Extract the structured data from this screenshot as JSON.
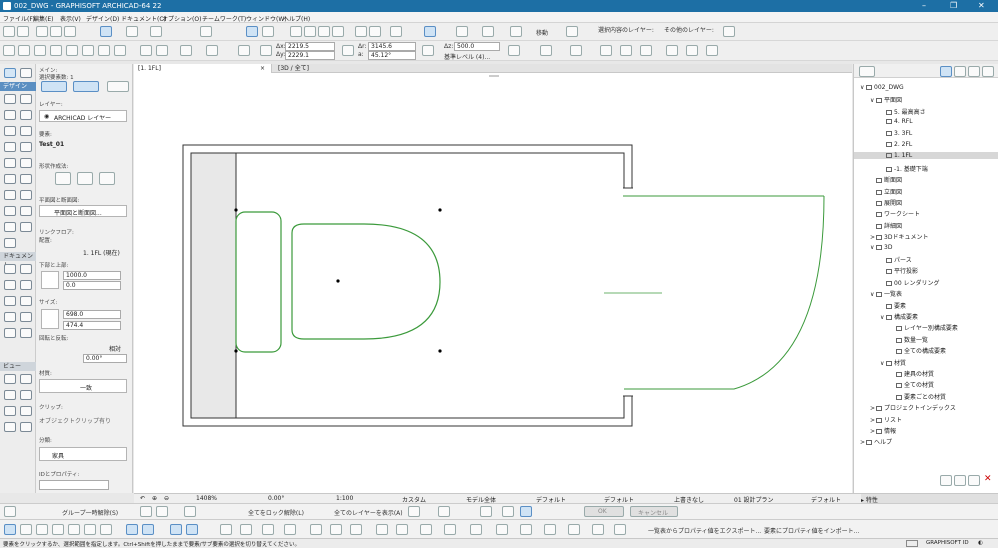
{
  "window": {
    "title": "002_DWG - GRAPHISOFT ARCHICAD-64 22",
    "minimize": "–",
    "maximize": "❐",
    "close": "✕"
  },
  "menu": [
    "ファイル(F)",
    "編集(E)",
    "表示(V)",
    "デザイン(D)",
    "ドキュメント(C)",
    "オプション(O)",
    "チームワーク(T)",
    "ウィンドウ(W)",
    "ヘルプ(H)"
  ],
  "toolbar": {
    "move_label": "移動",
    "layer1_label": "選択内容のレイヤー:",
    "layer2_label": "その他のレイヤー:",
    "delta_x_label": "Δx:",
    "delta_x": "2219.5",
    "delta_y_label": "Δy:",
    "delta_y": "2229.1",
    "r_label": "Δr:",
    "r_value": "3145.6",
    "a_label": "a:",
    "a_value": "45.12°",
    "dz_label": "Δz:",
    "dz_value": "500.0",
    "ref_label": "基準レベル (4)..."
  },
  "left_panel": {
    "tool_tab_design": "デザイン",
    "tool_tab_document": "ドキュメント",
    "tool_tab_view": "ビュー",
    "main_label": "メイン:",
    "selected_count": "選択要素数: 1",
    "layer_label": "レイヤー:",
    "layer_value": "ARCHICAD レイヤー",
    "element_label": "要素:",
    "element_value": "Test_01",
    "geom_label": "形状作成法:",
    "plan_section_label": "平面図と断面図:",
    "plan_section_value": "平面図と断面図...",
    "link_floor_label": "リンクフロア:",
    "link_floor_setting": "配置:",
    "link_floor_value": "1. 1FL (現在)",
    "bottom_label": "下部と上部:",
    "bottom_value": "1000.0",
    "top_value": "0.0",
    "size_label": "サイズ:",
    "width_value": "698.0",
    "depth_value": "474.4",
    "rotation_label": "回転と反転:",
    "rotation_mode": "相対",
    "rotation_value": "0.00°",
    "material_label": "材質:",
    "material_value": "一致",
    "clip_label": "クリップ:",
    "clip_value": "オブジェクトクリップ有り",
    "category_label": "分類:",
    "category_value": "家具",
    "idprop_label": "IDとプロパティ:"
  },
  "tabs": [
    {
      "label": "[1. 1FL]"
    },
    {
      "label": "[3D / 全て]"
    }
  ],
  "navigator": {
    "items": [
      {
        "label": "002_DWG",
        "level": 0,
        "expander": "∨"
      },
      {
        "label": "平面図",
        "level": 1,
        "expander": "∨"
      },
      {
        "label": "5. 最高高さ",
        "level": 2,
        "expander": ""
      },
      {
        "label": "4. RFL",
        "level": 2,
        "expander": ""
      },
      {
        "label": "3. 3FL",
        "level": 2,
        "expander": ""
      },
      {
        "label": "2. 2FL",
        "level": 2,
        "expander": ""
      },
      {
        "label": "1. 1FL",
        "level": 2,
        "expander": "",
        "selected": true
      },
      {
        "label": "-1. 基礎下端",
        "level": 2,
        "expander": ""
      },
      {
        "label": "断面図",
        "level": 1,
        "expander": ""
      },
      {
        "label": "立面図",
        "level": 1,
        "expander": ""
      },
      {
        "label": "展開図",
        "level": 1,
        "expander": ""
      },
      {
        "label": "ワークシート",
        "level": 1,
        "expander": ""
      },
      {
        "label": "詳細図",
        "level": 1,
        "expander": ""
      },
      {
        "label": "3Dドキュメント",
        "level": 1,
        "expander": ">"
      },
      {
        "label": "3D",
        "level": 1,
        "expander": "∨"
      },
      {
        "label": "パース",
        "level": 2,
        "expander": ""
      },
      {
        "label": "平行投影",
        "level": 2,
        "expander": ""
      },
      {
        "label": "00 レンダリング",
        "level": 2,
        "expander": ""
      },
      {
        "label": "一覧表",
        "level": 1,
        "expander": "∨"
      },
      {
        "label": "要素",
        "level": 2,
        "expander": ""
      },
      {
        "label": "構成要素",
        "level": 2,
        "expander": "∨"
      },
      {
        "label": "レイヤー別構成要素",
        "level": 3,
        "expander": ""
      },
      {
        "label": "数量一覧",
        "level": 3,
        "expander": ""
      },
      {
        "label": "全ての構成要素",
        "level": 3,
        "expander": ""
      },
      {
        "label": "材質",
        "level": 2,
        "expander": "∨"
      },
      {
        "label": "建具の材質",
        "level": 3,
        "expander": ""
      },
      {
        "label": "全ての材質",
        "level": 3,
        "expander": ""
      },
      {
        "label": "要素ごとの材質",
        "level": 3,
        "expander": ""
      },
      {
        "label": "プロジェクトインデックス",
        "level": 1,
        "expander": ">"
      },
      {
        "label": "リスト",
        "level": 1,
        "expander": ">"
      },
      {
        "label": "情報",
        "level": 1,
        "expander": ">"
      },
      {
        "label": "ヘルプ",
        "level": 0,
        "expander": ">"
      }
    ],
    "properties_label": "▸ 特性"
  },
  "status_row": {
    "zoom": "1408%",
    "angle": "0.00°",
    "scale": "1:100",
    "pen": "カスタム",
    "model": "モデル全体",
    "default1": "デフォルト",
    "default2": "デフォルト",
    "overwrite": "上書きなし",
    "plan": "01 設計プラン",
    "default3": "デフォルト"
  },
  "bottom_bar": {
    "group_label": "グループ一時解除(S)",
    "lock_label": "全てをロック解除(L)",
    "show_layers_label": "全てのレイヤーを表示(A)",
    "ok_label": "OK",
    "cancel_label": "キャンセル",
    "export_label": "一覧表からプロパティ値をエクスポート...",
    "import_label": "要素にプロパティ値をインポート...",
    "status_text": "要素をクリックするか、選択範囲を指定します。Ctrl+Shiftを押したままで要素/サブ要素の選択を切り替えてください。",
    "graphisoft_id": "GRAPHISOFT ID"
  },
  "colors": {
    "accent": "#1d6fa5",
    "drawing_green": "#3b9a3b",
    "selection_blue": "#5b8fc2"
  }
}
